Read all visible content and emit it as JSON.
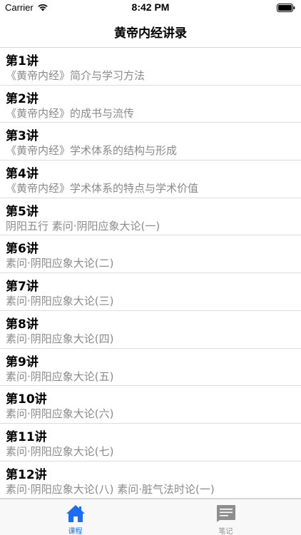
{
  "status_bar": {
    "carrier": "Carrier",
    "time": "8:42 PM"
  },
  "nav": {
    "title": "黄帝内经讲录"
  },
  "lessons": [
    {
      "title": "第1讲",
      "subtitle": "《黄帝内经》简介与学习方法"
    },
    {
      "title": "第2讲",
      "subtitle": "《黄帝内经》的成书与流传"
    },
    {
      "title": "第3讲",
      "subtitle": "《黄帝内经》学术体系的结构与形成"
    },
    {
      "title": "第4讲",
      "subtitle": "《黄帝内经》学术体系的特点与学术价值"
    },
    {
      "title": "第5讲",
      "subtitle": "阴阳五行 素问·阴阳应象大论(一)"
    },
    {
      "title": "第6讲",
      "subtitle": "素问·阴阳应象大论(二)"
    },
    {
      "title": "第7讲",
      "subtitle": "素问·阴阳应象大论(三)"
    },
    {
      "title": "第8讲",
      "subtitle": "素问·阴阳应象大论(四)"
    },
    {
      "title": "第9讲",
      "subtitle": "素问·阴阳应象大论(五)"
    },
    {
      "title": "第10讲",
      "subtitle": "素问·阴阳应象大论(六)"
    },
    {
      "title": "第11讲",
      "subtitle": "素问·阴阳应象大论(七)"
    },
    {
      "title": "第12讲",
      "subtitle": "素问·阴阳应象大论(八)  素问·脏气法时论(一)"
    }
  ],
  "tabs": [
    {
      "label": "课程",
      "icon": "home-icon",
      "active": true
    },
    {
      "label": "笔记",
      "icon": "notes-icon",
      "active": false
    }
  ],
  "colors": {
    "accent": "#1a6ef5",
    "inactive": "#8e8e8e",
    "subtitle": "#8a8a8a"
  }
}
